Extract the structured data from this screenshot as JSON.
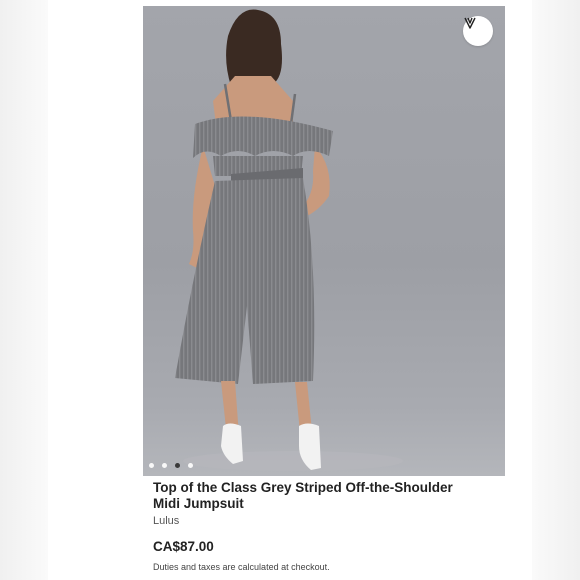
{
  "product": {
    "title": "Top of the Class Grey Striped Off-the-Shoulder Midi Jumpsuit",
    "brand": "Lulus",
    "price": "CA$87.00",
    "duties_note": "Duties and taxes are calculated at checkout."
  },
  "gallery": {
    "image_count": 4,
    "active_index": 2,
    "like_icon": "v-logo-icon"
  },
  "colors": {
    "backdrop": "#9d9fa5",
    "garment": "#6f7074",
    "text": "#222222"
  }
}
